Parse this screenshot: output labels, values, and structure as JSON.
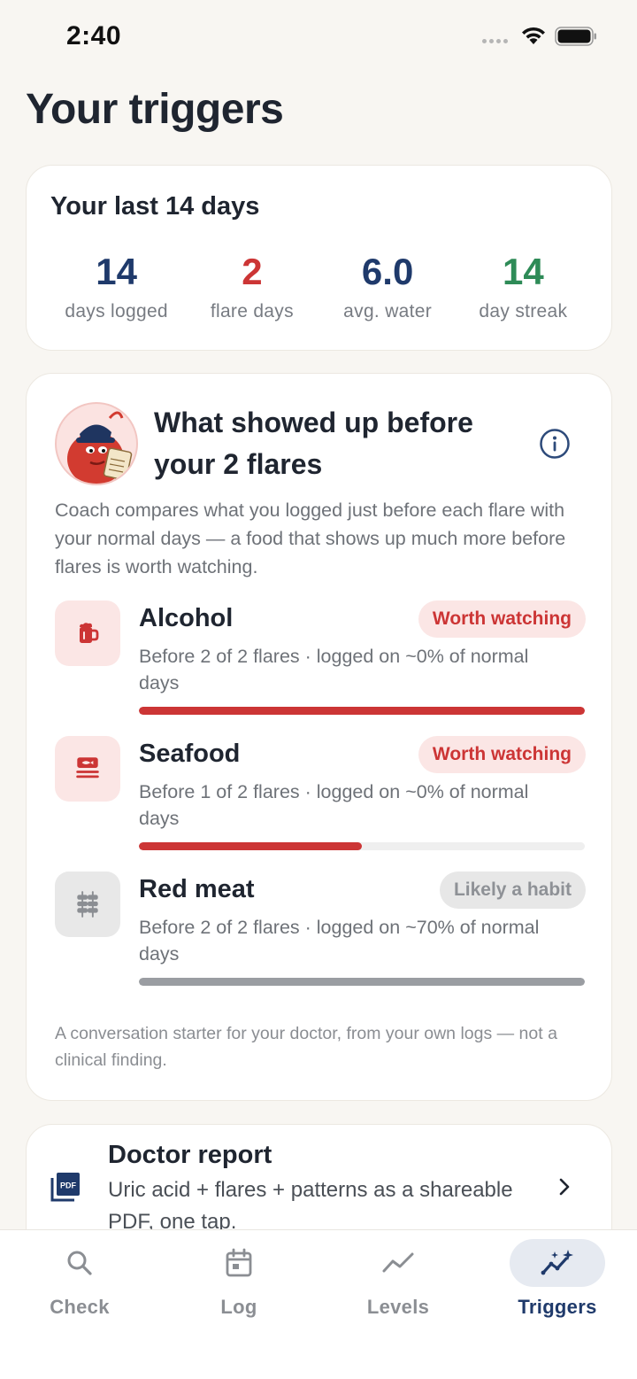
{
  "status_bar": {
    "time": "2:40"
  },
  "page": {
    "title": "Your triggers"
  },
  "summary": {
    "title": "Your last 14 days",
    "stats": [
      {
        "value": "14",
        "label": "days logged",
        "color": "#1f3a6b"
      },
      {
        "value": "2",
        "label": "flare days",
        "color": "#cc3535"
      },
      {
        "value": "6.0",
        "label": "avg. water",
        "color": "#1f3a6b"
      },
      {
        "value": "14",
        "label": "day streak",
        "color": "#2e8b57"
      }
    ]
  },
  "triggers": {
    "heading": "What showed up before your 2 flares",
    "description": "Coach compares what you logged just before each flare with your normal days — a food that shows up much more before flares is worth watching.",
    "items": [
      {
        "name": "Alcohol",
        "icon": "beer-mug-icon",
        "badge": "Worth watching",
        "badge_kind": "watch",
        "detail": "Before 2 of 2 flares · logged on ~0% of normal days",
        "share": 1.0,
        "bar_color": "#cc3535"
      },
      {
        "name": "Seafood",
        "icon": "fish-icon",
        "badge": "Worth watching",
        "badge_kind": "watch",
        "detail": "Before 1 of 2 flares · logged on ~0% of normal days",
        "share": 0.5,
        "bar_color": "#cc3535"
      },
      {
        "name": "Red meat",
        "icon": "skewer-icon",
        "badge": "Likely a habit",
        "badge_kind": "habit",
        "detail": "Before 2 of 2 flares · logged on ~70% of normal days",
        "share": 1.0,
        "bar_color": "#9a9da2"
      }
    ],
    "disclaimer": "A conversation starter for your doctor, from your own logs — not a clinical finding."
  },
  "report": {
    "title": "Doctor report",
    "description": "Uric acid + flares + patterns as a shareable PDF, one tap."
  },
  "tabs": [
    {
      "label": "Check",
      "icon": "search-icon",
      "active": false
    },
    {
      "label": "Log",
      "icon": "calendar-icon",
      "active": false
    },
    {
      "label": "Levels",
      "icon": "trend-line-icon",
      "active": false
    },
    {
      "label": "Triggers",
      "icon": "sparkle-trend-icon",
      "active": true
    }
  ],
  "colors": {
    "accent": "#1f3a6b",
    "danger": "#cc3535",
    "success": "#2e8b57"
  }
}
